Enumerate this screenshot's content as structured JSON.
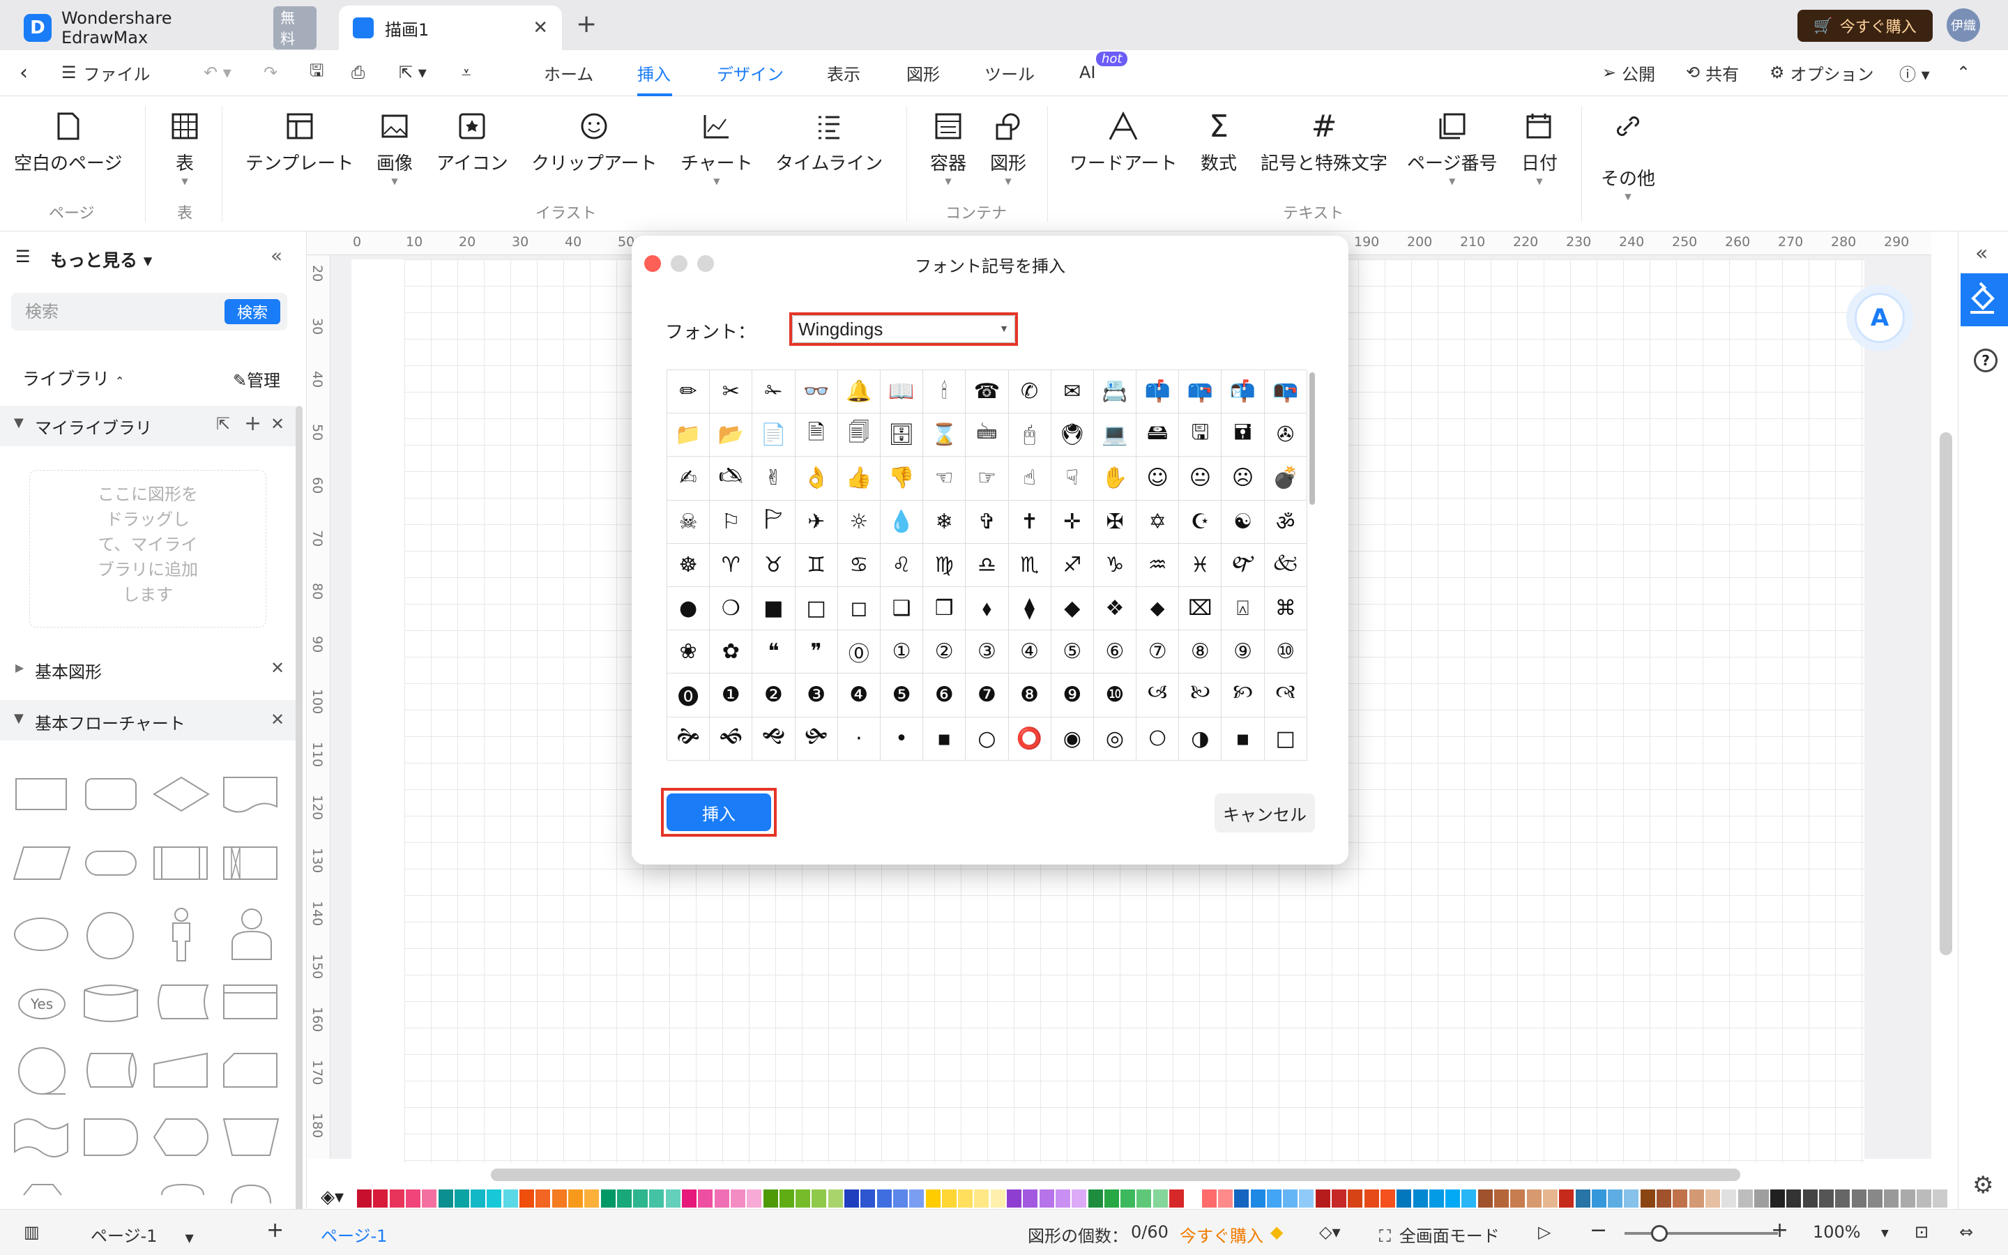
{
  "titlebar": {
    "app_name": "Wondershare EdrawMax",
    "free_badge": "無料",
    "doc_tab": "描画1",
    "buy": "今すぐ購入",
    "user": "伊織"
  },
  "menubar": {
    "file": "ファイル",
    "tabs": [
      "ホーム",
      "挿入",
      "デザイン",
      "表示",
      "図形",
      "ツール",
      "AI"
    ],
    "hot": "hot",
    "publish": "公開",
    "share": "共有",
    "options": "オプション"
  },
  "ribbon": {
    "items": [
      "空白のページ",
      "表",
      "テンプレート",
      "画像",
      "アイコン",
      "クリップアート",
      "チャート",
      "タイムライン",
      "容器",
      "図形",
      "ワードアート",
      "数式",
      "記号と特殊文字",
      "ページ番号",
      "日付",
      "その他"
    ],
    "groups": [
      "ページ",
      "表",
      "イラスト",
      "コンテナ",
      "テキスト"
    ]
  },
  "leftpanel": {
    "more": "もっと見る",
    "search_placeholder": "検索",
    "search_btn": "検索",
    "library": "ライブラリ",
    "manage": "管理",
    "my_library": "マイライブラリ",
    "drop_hint": [
      "ここに図形を",
      "ドラッグし",
      "て、マイライ",
      "ブラリに追加",
      "します"
    ],
    "basic_shapes": "基本図形",
    "basic_flowchart": "基本フローチャート",
    "yes": "Yes"
  },
  "ruler": {
    "top": [
      "0",
      "10",
      "20",
      "30",
      "40",
      "50",
      "190",
      "200",
      "210",
      "220",
      "230",
      "240",
      "250",
      "260",
      "270",
      "280",
      "290"
    ],
    "left": [
      "20",
      "30",
      "40",
      "50",
      "60",
      "70",
      "80",
      "90",
      "100",
      "110",
      "120",
      "130",
      "140",
      "150",
      "160",
      "170",
      "180"
    ]
  },
  "dialog": {
    "title": "フォント記号を挿入",
    "font_label": "フォント：",
    "font_value": "Wingdings",
    "insert": "挿入",
    "cancel": "キャンセル",
    "symbols": [
      "✏",
      "✂",
      "✁",
      "👓",
      "🔔",
      "📖",
      "🕯",
      "☎",
      "✆",
      "✉",
      "📇",
      "📫",
      "📪",
      "📬",
      "📭",
      "📁",
      "📂",
      "📄",
      "🗎",
      "🗐",
      "🗄",
      "⌛",
      "🖮",
      "🖰",
      "🖲",
      "💻",
      "🖴",
      "🖫",
      "🖬",
      "✇",
      "✍",
      "🖎",
      "✌",
      "👌",
      "👍",
      "👎",
      "☜",
      "☞",
      "☝",
      "☟",
      "✋",
      "☺",
      "😐",
      "☹",
      "💣",
      "☠",
      "⚐",
      "🏱",
      "✈",
      "☼",
      "💧",
      "❄",
      "✞",
      "✝",
      "✛",
      "✠",
      "✡",
      "☪",
      "☯",
      "ॐ",
      "☸",
      "♈",
      "♉",
      "♊",
      "♋",
      "♌",
      "♍",
      "♎",
      "♏",
      "♐",
      "♑",
      "♒",
      "♓",
      "🙰",
      "🙵",
      "●",
      "❍",
      "■",
      "□",
      "◻",
      "❑",
      "❒",
      "⬧",
      "⧫",
      "◆",
      "❖",
      "⬥",
      "⌧",
      "⍓",
      "⌘",
      "❀",
      "✿",
      "❝",
      "❞",
      "⓪",
      "①",
      "②",
      "③",
      "④",
      "⑤",
      "⑥",
      "⑦",
      "⑧",
      "⑨",
      "⑩",
      "⓿",
      "❶",
      "❷",
      "❸",
      "❹",
      "❺",
      "❻",
      "❼",
      "❽",
      "❾",
      "❿",
      "🙢",
      "🙠",
      "🙡",
      "🙣",
      "🙞",
      "🙜",
      "🙝",
      "🙟",
      "·",
      "•",
      "▪",
      "○",
      "⭕",
      "◉",
      "◎",
      "🞅",
      "◑",
      "▪",
      "□"
    ]
  },
  "colors": {
    "accent": "#1a7cf7",
    "highlight": "#e53527",
    "buy_bg": "#3b2312",
    "palette": [
      "#c8102e",
      "#d81b3a",
      "#e8345b",
      "#f0447a",
      "#f36fa0",
      "#0b8f8f",
      "#0ba3a3",
      "#13b8c6",
      "#18c8d8",
      "#5bd8e5",
      "#f04e0d",
      "#f26522",
      "#f47b20",
      "#f79a1c",
      "#fbb03b",
      "#009966",
      "#18a879",
      "#2db58f",
      "#44c2a4",
      "#64cfba",
      "#e6197a",
      "#ee4fa1",
      "#f06eb3",
      "#f48cc4",
      "#f7aad6",
      "#4e9a06",
      "#5fad12",
      "#76bb2a",
      "#8fc94a",
      "#a9d46c",
      "#1f3fbf",
      "#2e56d1",
      "#3f6ee0",
      "#5b86ea",
      "#7a9ef2",
      "#ffcc00",
      "#ffd633",
      "#ffdf5c",
      "#ffe885",
      "#fff0ad",
      "#8e3fd1",
      "#a259e0",
      "#b673ea",
      "#c98ff2",
      "#dcaaf7",
      "#1e8e3e",
      "#28a745",
      "#3cb95c",
      "#5fc878",
      "#85d69a",
      "#d62828",
      "#ffffff",
      "#ff6b6b",
      "#ff8a8a",
      "#1565c0",
      "#1e88e5",
      "#42a5f5",
      "#64b5f6",
      "#90caf9",
      "#b71c1c",
      "#c62828",
      "#d84315",
      "#e64a19",
      "#f4511e",
      "#0277bd",
      "#0288d1",
      "#039be5",
      "#03a9f4",
      "#29b6f6",
      "#a0522d",
      "#b5653a",
      "#c77d4f",
      "#d79a6f",
      "#e6b690",
      "#c62a1a",
      "#2874a6",
      "#3498db",
      "#5dade2",
      "#85c1e9",
      "#8b4513",
      "#a0522d",
      "#c0714a",
      "#d39874",
      "#e6bfa2",
      "#e0e0e0",
      "#bdbdbd",
      "#9e9e9e",
      "#212121",
      "#333333",
      "#444444",
      "#555555",
      "#666666",
      "#777777",
      "#888888",
      "#999999",
      "#aaaaaa",
      "#bbbbbb",
      "#cccccc"
    ]
  },
  "statusbar": {
    "page_select": "ページ-1",
    "page_tab": "ページ-1",
    "shape_count": "図形の個数：",
    "shape_count_value": "0/60",
    "buy_now": "今すぐ購入",
    "fullscreen": "全画面モード",
    "zoom": "100%"
  }
}
